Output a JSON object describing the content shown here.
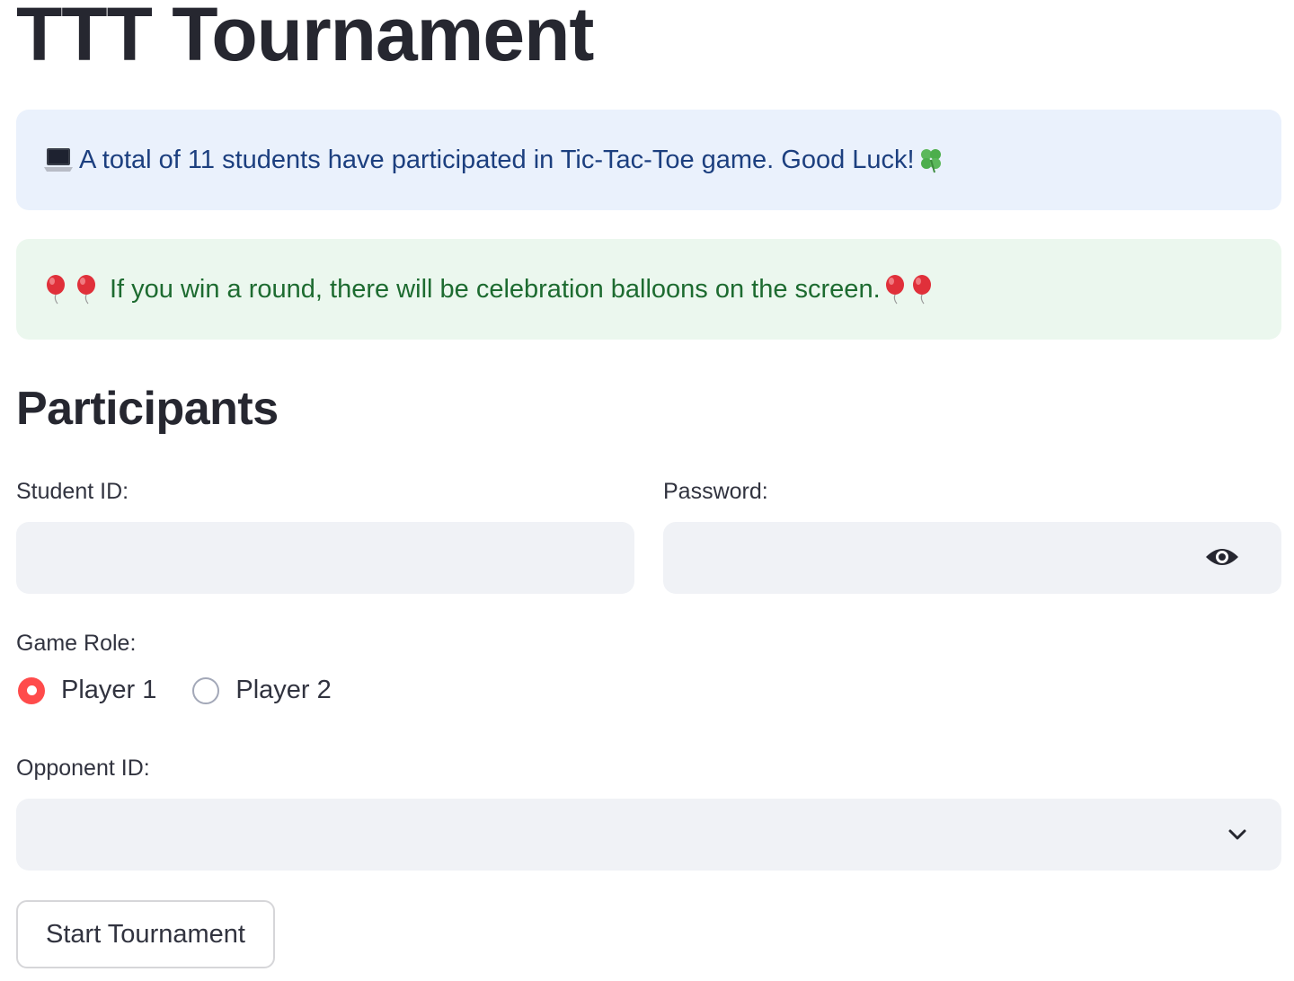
{
  "page": {
    "title": "TTT Tournament"
  },
  "info_alert": {
    "icon": "laptop-icon",
    "text": "A total of 11 students have participated in Tic-Tac-Toe game. Good Luck!",
    "trailing_icon": "four-leaf-clover-icon"
  },
  "success_alert": {
    "leading_icons": [
      "balloon-icon",
      "balloon-icon"
    ],
    "text": "If you win a round, there will be celebration balloons on the screen.",
    "trailing_icons": [
      "balloon-icon",
      "balloon-icon"
    ]
  },
  "participants": {
    "title": "Participants",
    "student_id": {
      "label": "Student ID:",
      "value": "",
      "placeholder": ""
    },
    "password": {
      "label": "Password:",
      "value": "",
      "placeholder": "",
      "toggle_icon": "eye-icon"
    },
    "game_role": {
      "label": "Game Role:",
      "options": [
        {
          "label": "Player 1",
          "selected": true
        },
        {
          "label": "Player 2",
          "selected": false
        }
      ]
    },
    "opponent_id": {
      "label": "Opponent ID:",
      "selected_value": "",
      "icon": "chevron-down-icon"
    },
    "start_button": {
      "label": "Start Tournament"
    }
  },
  "colors": {
    "accent": "#ff4b4b",
    "info_bg": "#eaf1fc",
    "info_text": "#1c3f7f",
    "success_bg": "#ebf7ee",
    "success_text": "#1d6b30",
    "input_bg": "#f0f2f6"
  }
}
